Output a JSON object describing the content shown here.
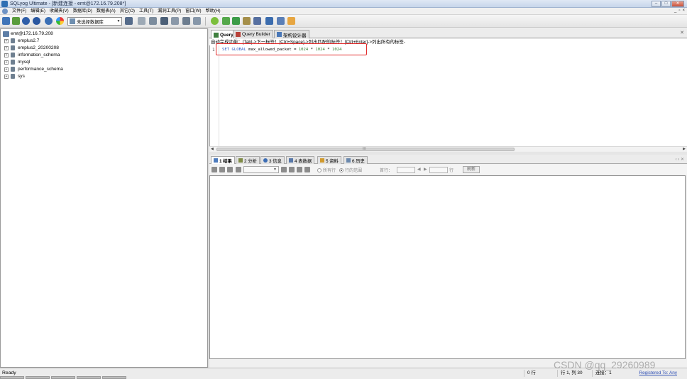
{
  "window": {
    "title": "SQLyog Ultimate - [新建连接 - emt@172.16.79.208*]"
  },
  "menu": {
    "items": [
      "文件(F)",
      "编辑(E)",
      "收藏夹(V)",
      "数据库(D)",
      "数据表(A)",
      "其它(O)",
      "工具(T)",
      "漏洞工具(P)",
      "窗口(W)",
      "帮助(H)"
    ]
  },
  "toolbar": {
    "database_select": "未选择数据库"
  },
  "tree": {
    "root": "emt@172.16.79.208",
    "databases": [
      "emplus2.7",
      "emplus2_20200208",
      "information_schema",
      "mysql",
      "performance_schema",
      "sys"
    ]
  },
  "editor": {
    "tabs": [
      "Query",
      "Query Builder",
      "架构设计器"
    ],
    "hint": "自动完成功能：[Tab]->下一标签！[Ctrl+Space]->列出匹配的标签！[Ctrl+Enter]->列出所有的标签-",
    "line_number": "1",
    "code": {
      "kw1": "SET",
      "kw2": "GLOBAL",
      "rest": "max_allowed_packet = ",
      "n1": "1024",
      "op1": " * ",
      "n2": "1024",
      "op2": " * ",
      "n3": "1024"
    },
    "scroll_marker": "III"
  },
  "results": {
    "tabs": [
      "1 结果",
      "2 分析",
      "3 信息",
      "4 表数据",
      "5 资料",
      "6 历史"
    ],
    "radio_all_rows": "所有行",
    "radio_row_range": "行的范围",
    "first_row_label": "首行：",
    "rows_label": "行",
    "refresh_button": "刷新"
  },
  "status": {
    "ready": "Ready",
    "exec": "0 行",
    "position": "行 1, 列 30",
    "connection": "连接：1",
    "registered": "Registered To: Any"
  },
  "watermark": "CSDN @qq_29260989",
  "colors": {
    "highlight_box": "#e22b2b",
    "sql_keyword": "#2b5cc8",
    "sql_number": "#2b7a2b"
  }
}
